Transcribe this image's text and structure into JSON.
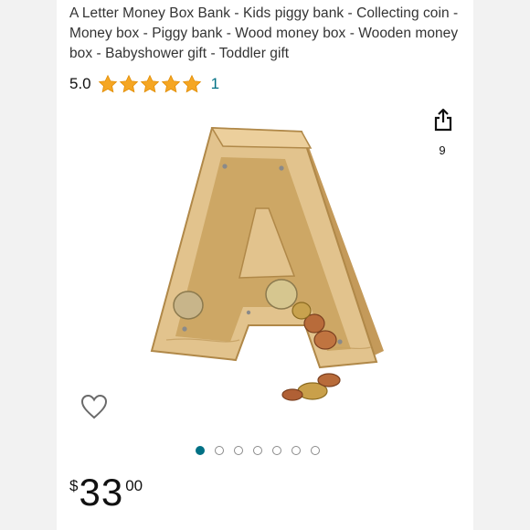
{
  "product": {
    "title": "A Letter Money Box Bank - Kids piggy bank - Collecting coin - Money box - Piggy bank - Wood money box - Wooden money box - Babyshower gift - Toddler gift",
    "rating": {
      "value": "5.0",
      "stars": 5,
      "count": "1"
    },
    "share": {
      "icon": "share-icon",
      "count": "9"
    },
    "image": {
      "subject": "wooden letter A money box with coins",
      "wood_color": "#d9b77c",
      "window_color": "#c9a25e"
    },
    "wishlist": {
      "icon": "heart-outline-icon"
    },
    "carousel": {
      "total": 7,
      "active": 0
    },
    "price": {
      "symbol": "$",
      "whole": "33",
      "fraction": "00"
    }
  },
  "colors": {
    "accent": "#007185",
    "star": "#f5a623",
    "text": "#333333"
  }
}
